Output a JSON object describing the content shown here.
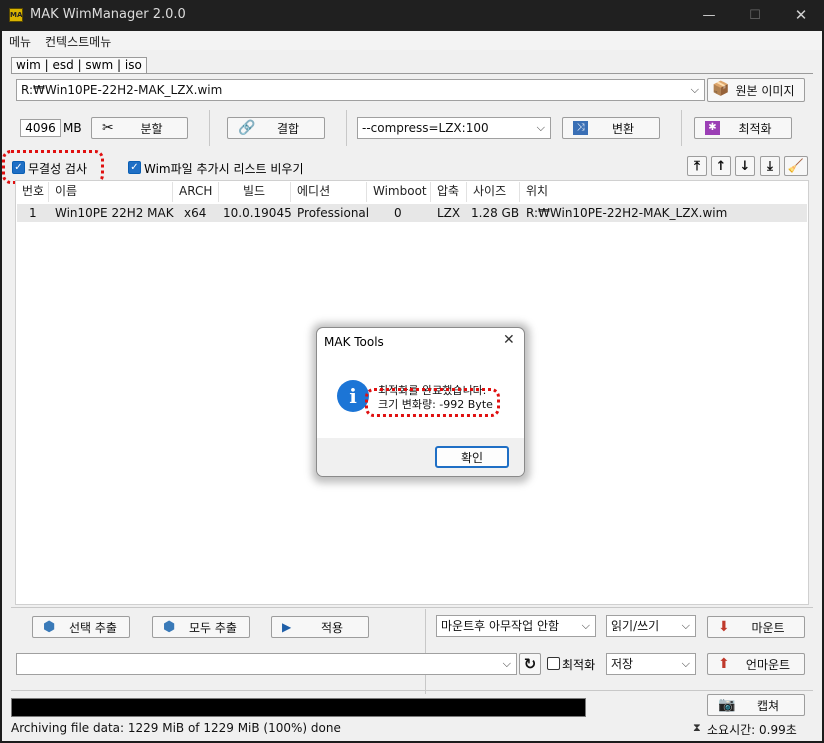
{
  "window": {
    "title": "MAK WimManager 2.0.0",
    "icon_text": "MAK"
  },
  "menu": {
    "items": [
      "메뉴",
      "컨텍스트메뉴"
    ]
  },
  "tabs": {
    "label": "wim | esd | swm | iso"
  },
  "source": {
    "path": "R:₩Win10PE-22H2-MAK_LZX.wim",
    "button": "원본 이미지"
  },
  "toolbar": {
    "split_size": "4096",
    "split_unit": "MB",
    "split_button": "분할",
    "join_button": "결합",
    "compress_option": "--compress=LZX:100",
    "convert_button": "변환",
    "optimize_button": "최적화"
  },
  "options": {
    "integrity_check": {
      "label": "무결성 검사",
      "checked": true
    },
    "clear_list": {
      "label": "Wim파일 추가시 리스트 비우기",
      "checked": true
    }
  },
  "table": {
    "columns": [
      "번호",
      "이름",
      "ARCH",
      "빌드",
      "에디션",
      "Wimboot",
      "압축",
      "사이즈",
      "위치"
    ],
    "rows": [
      {
        "num": "1",
        "name": "Win10PE 22H2 MAK",
        "arch": "x64",
        "build": "10.0.19045",
        "edition": "Professional",
        "wimboot": "0",
        "compress": "LZX",
        "size": "1.28 GB",
        "location": "R:₩Win10PE-22H2-MAK_LZX.wim"
      }
    ]
  },
  "dialog": {
    "title": "MAK Tools",
    "line1": "최적화를 완료했습니다.",
    "line2": "크기 변화량: -992 Byte",
    "ok": "확인"
  },
  "bottom": {
    "extract_selected": "선택 추출",
    "extract_all": "모두 추출",
    "apply": "적용",
    "after_mount": "마운트후 아무작업 안함",
    "access_mode": "읽기/쓰기",
    "mount_button": "마운트",
    "path": "",
    "optimize_label": "최적화",
    "optimize_checked": false,
    "save_mode": "저장",
    "unmount_button": "언마운트",
    "capture_button": "캡쳐"
  },
  "status": {
    "progress": 1.0,
    "text": "Archiving file data: 1229 MiB of 1229 MiB (100%) done",
    "elapsed": "소요시간: 0.99초"
  },
  "colors": {
    "accent": "#1f6fc5",
    "highlight": "#e01010",
    "titlebar": "#202020"
  }
}
